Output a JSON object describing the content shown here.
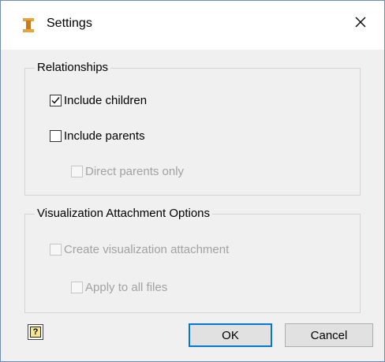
{
  "window": {
    "title": "Settings",
    "close_icon": "close-icon",
    "app_icon": "inventor-app-icon",
    "accent_color": "#0078d7"
  },
  "relationships": {
    "legend": "Relationships",
    "include_children": {
      "label": "Include children",
      "checked": true,
      "enabled": true
    },
    "include_parents": {
      "label": "Include parents",
      "checked": false,
      "enabled": true
    },
    "direct_parents_only": {
      "label": "Direct parents only",
      "checked": false,
      "enabled": false
    }
  },
  "visualization": {
    "legend": "Visualization Attachment Options",
    "create_attachment": {
      "label": "Create visualization attachment",
      "checked": false,
      "enabled": false
    },
    "apply_to_all": {
      "label": "Apply to all files",
      "checked": false,
      "enabled": false
    }
  },
  "footer": {
    "help_icon": "help-icon",
    "ok_label": "OK",
    "cancel_label": "Cancel"
  }
}
